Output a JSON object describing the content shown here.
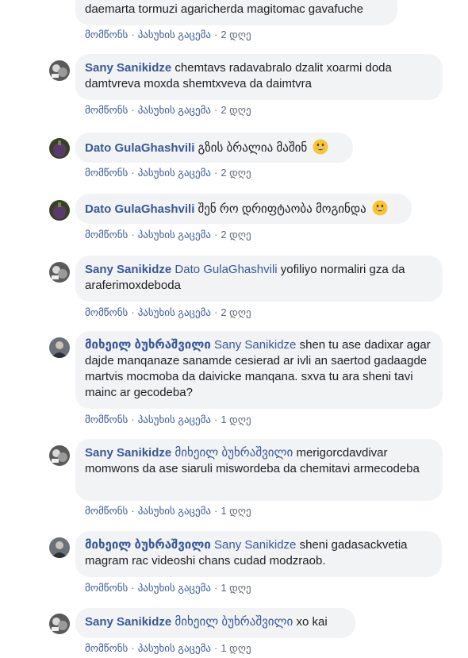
{
  "actions": {
    "like": "მომწონს",
    "reply": "პასუხის გაცემა",
    "sep": "·"
  },
  "comments": [
    {
      "author": "",
      "tag": "",
      "text": "daemarta tormuzi agaricherda magitomac gavafuche",
      "time": "2 დღე"
    },
    {
      "author": "Sany Sanikidze",
      "tag": "",
      "text": "chemtavs radavabralo dzalit xoarmi doda damtvreva moxda shemtxveva da daimtvra",
      "time": "2 დღე"
    },
    {
      "author": "Dato GulaGhashvili",
      "tag": "",
      "text": "გზის ბრალია მაშინ",
      "emoji": "grinning-face-emoji",
      "time": "2 დღე"
    },
    {
      "author": "Dato GulaGhashvili",
      "tag": "",
      "text": "შენ რო დრიფტაობა მოგინდა",
      "emoji": "grinning-face-emoji",
      "time": "2 დღე"
    },
    {
      "author": "Sany Sanikidze",
      "tag": "Dato GulaGhashvili",
      "text": "yofiliyo normaliri gza da araferimoxdeboda",
      "time": "2 დღე"
    },
    {
      "author": "მიხეილ ბუხრაშვილი",
      "tag": "Sany Sanikidze",
      "text": "shen tu ase dadixar agar dajde manqanaze sanamde cesierad ar ivli an saertod gadaagde martvis mocmoba da daivicke manqana. sxva tu ara sheni tavi mainc ar gecodeba?",
      "time": "1 დღე"
    },
    {
      "author": "Sany Sanikidze",
      "tag": "მიხეილ ბუხრაშვილი",
      "text": "merigorcdavdivar momwons da ase siaruli miswordeba da chemitavi armecodeba",
      "time": "1 დღე"
    },
    {
      "author": "მიხეილ ბუხრაშვილი",
      "tag": "Sany Sanikidze",
      "text": "sheni gadasackvetia magram rac videoshi chans cudad modzraob.",
      "time": "1 დღე"
    },
    {
      "author": "Sany Sanikidze",
      "tag": "მიხეილ ბუხრაშვილი",
      "text": "xo kai",
      "time": "1 დღე"
    }
  ]
}
